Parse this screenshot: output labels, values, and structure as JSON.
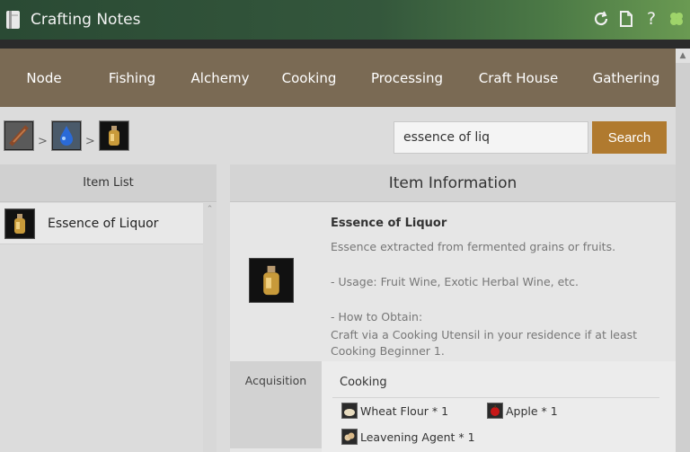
{
  "window": {
    "title": "Crafting Notes",
    "icons": [
      "book-icon",
      "refresh-icon",
      "document-icon",
      "help-icon",
      "clover-icon"
    ],
    "help_glyph": "?"
  },
  "nav": {
    "tabs": [
      {
        "label": "Node"
      },
      {
        "label": "Fishing"
      },
      {
        "label": "Alchemy"
      },
      {
        "label": "Cooking"
      },
      {
        "label": "Processing"
      },
      {
        "label": "Craft House"
      },
      {
        "label": "Gathering"
      }
    ]
  },
  "breadcrumb": {
    "separator": ">",
    "items": [
      "stick-item-icon",
      "blue-essence-icon",
      "liquor-bottle-icon"
    ]
  },
  "search": {
    "value": "essence of liq",
    "button_label": "Search"
  },
  "item_list": {
    "header": "Item List",
    "items": [
      {
        "name": "Essence of Liquor",
        "icon": "liquor-bottle-icon"
      }
    ]
  },
  "item_info": {
    "header": "Item Information",
    "name": "Essence of Liquor",
    "description": "Essence extracted from fermented grains or fruits.",
    "usage": "- Usage: Fruit Wine, Exotic Herbal Wine, etc.",
    "obtain_label": "- How to Obtain:",
    "obtain_detail": "Craft via a Cooking Utensil in your residence if at least Cooking Beginner 1."
  },
  "acquisition": {
    "label": "Acquisition",
    "method": "Cooking",
    "materials": [
      {
        "name": "Wheat Flour * 1",
        "icon": "wheat-flour-icon"
      },
      {
        "name": "Apple * 1",
        "icon": "apple-icon"
      },
      {
        "name": "Leavening Agent * 1",
        "icon": "leavening-agent-icon"
      }
    ]
  },
  "colors": {
    "title_bar": "#34573c",
    "nav_bar": "#7a6a54",
    "search_button": "#b07a2f"
  }
}
